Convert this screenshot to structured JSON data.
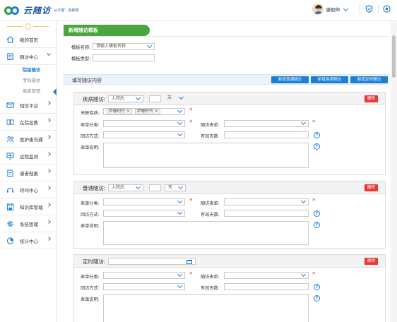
{
  "header": {
    "logo_text": "云随访",
    "logo_sub": "山东健 · 互联网",
    "user_name": "唐毅伸"
  },
  "sidebar": {
    "items": [
      {
        "label": "我的首页",
        "icon": "home-icon"
      },
      {
        "label": "随访中心",
        "icon": "clipboard-icon"
      },
      {
        "label": "短信平台",
        "icon": "mail-icon"
      },
      {
        "label": "在院宣教",
        "icon": "book-icon"
      },
      {
        "label": "医护患沟通",
        "icon": "people-icon"
      },
      {
        "label": "远程监测",
        "icon": "monitor-icon"
      },
      {
        "label": "患者档案",
        "icon": "file-icon"
      },
      {
        "label": "呼叫中心",
        "icon": "headset-icon"
      },
      {
        "label": "知识库管理",
        "icon": "save-icon"
      },
      {
        "label": "系统管理",
        "icon": "gear-icon"
      },
      {
        "label": "统计中心",
        "icon": "pie-icon"
      }
    ],
    "sub_items": [
      "院级随访",
      "专科随访",
      "患者管理"
    ]
  },
  "main": {
    "tab_title": "新增随访模板",
    "template_name_label": "模板名称:",
    "template_name_placeholder": "请输入模板名称",
    "template_type_label": "模板类型:",
    "section_title": "填写随访内容",
    "buttons": [
      "新增普通随访",
      "新增疾病随访",
      "新增定时随访"
    ],
    "delete_label": "删除",
    "disease_block": {
      "title": "疾病随访:",
      "timing": "入院后",
      "unit": "天",
      "disease_label": "关联疾病:",
      "tags": [
        "萨睡时代 ×",
        "萨睡时代 ×"
      ],
      "form_cat_label": "表单分类:",
      "followup_form_label": "随访表单:",
      "method_label": "回访方式:",
      "valid_days_label": "有效天数",
      "desc_label": "表单说明:"
    },
    "normal_block": {
      "title": "普通随访:",
      "timing": "入院后",
      "unit": "天",
      "form_cat_label": "表单分类:",
      "followup_form_label": "随访表单:",
      "method_label": "回访方式:",
      "valid_days_label": "有效天数:",
      "desc_label": "表单说明:"
    },
    "timed_block": {
      "title": "定时随访:",
      "form_cat_label": "表单分类:",
      "followup_form_label": "随访表单:",
      "method_label": "回访方式:",
      "valid_days_label": "有效天数:",
      "desc_label": "表单说明:"
    }
  },
  "colors": {
    "primary": "#1e7fd6",
    "green": "#4aa53e",
    "danger": "#e53935"
  }
}
